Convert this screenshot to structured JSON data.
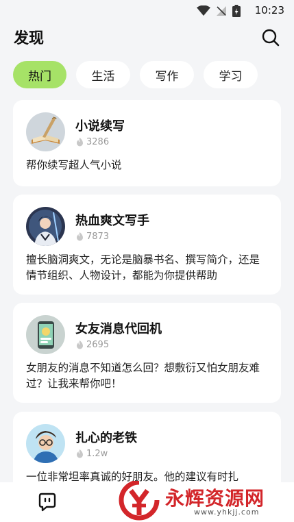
{
  "status_bar": {
    "time": "10:23"
  },
  "header": {
    "title": "发现"
  },
  "tabs": [
    {
      "label": "热门",
      "active": true
    },
    {
      "label": "生活",
      "active": false
    },
    {
      "label": "写作",
      "active": false
    },
    {
      "label": "学习",
      "active": false
    }
  ],
  "cards": [
    {
      "title": "小说续写",
      "count": "3286",
      "description": "帮你续写超人气小说",
      "avatar_icon": "quill-book-icon"
    },
    {
      "title": "热血爽文写手",
      "count": "7873",
      "description": "擅长脑洞爽文，无论是脑暴书名、撰写简介，还是情节组织、人物设计，都能为你提供帮助",
      "avatar_icon": "warrior-avatar-icon"
    },
    {
      "title": "女友消息代回机",
      "count": "2695",
      "description": "女朋友的消息不知道怎么回？想敷衍又怕女朋友难过？让我来帮你吧！",
      "avatar_icon": "phone-chat-icon"
    },
    {
      "title": "扎心的老铁",
      "count": "1.2w",
      "description": "一位非常坦率真诚的好朋友。他的建议有时扎",
      "avatar_icon": "glasses-guy-icon"
    }
  ],
  "watermark": {
    "brand": "永辉资源网",
    "url": "www.yhkjj.com"
  },
  "colors": {
    "accent": "#a6e267",
    "background": "#f4f5f7",
    "card": "#ffffff",
    "watermark": "#d3262a"
  }
}
